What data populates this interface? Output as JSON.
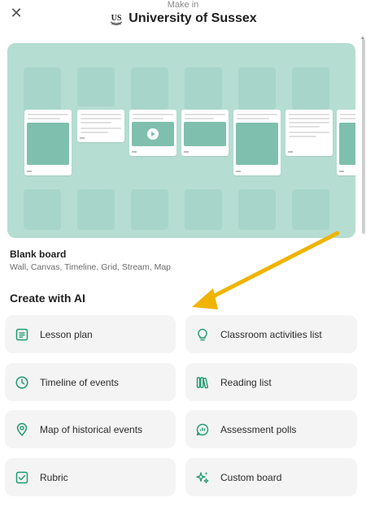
{
  "header": {
    "make_in": "Make in",
    "org_name": "University of Sussex"
  },
  "blank_board": {
    "title": "Blank board",
    "subtitle": "Wall, Canvas, Timeline, Grid, Stream, Map"
  },
  "ai_section": {
    "title": "Create with AI",
    "tiles": [
      {
        "label": "Lesson plan",
        "icon": "document-icon"
      },
      {
        "label": "Classroom activities list",
        "icon": "lightbulb-icon"
      },
      {
        "label": "Timeline of events",
        "icon": "clock-icon"
      },
      {
        "label": "Reading list",
        "icon": "books-icon"
      },
      {
        "label": "Map of historical events",
        "icon": "map-pin-icon"
      },
      {
        "label": "Assessment polls",
        "icon": "chat-poll-icon"
      },
      {
        "label": "Rubric",
        "icon": "checkbox-icon"
      },
      {
        "label": "Custom board",
        "icon": "sparkles-icon"
      }
    ]
  },
  "colors": {
    "accent": "#1f9a72",
    "preview_bg": "#b5ddd2",
    "tile_bg": "#f4f4f4",
    "arrow": "#f0b400"
  }
}
